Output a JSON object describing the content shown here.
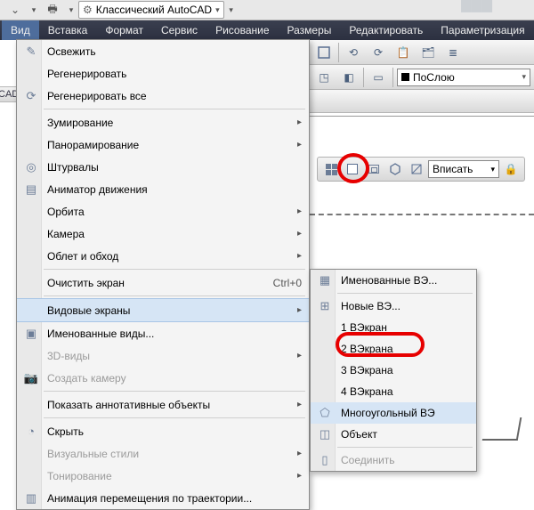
{
  "workspace": {
    "label": "Классический AutoCAD"
  },
  "menubar": {
    "items": [
      "Вид",
      "Вставка",
      "Формат",
      "Сервис",
      "Рисование",
      "Размеры",
      "Редактировать",
      "Параметризация"
    ],
    "active_index": 0
  },
  "layer": {
    "label": "ПоСлою"
  },
  "vp_strip": {
    "combo": "Вписать"
  },
  "sliver": "CAD",
  "menu": {
    "refresh": "Освежить",
    "regen": "Регенерировать",
    "regen_all": "Регенерировать все",
    "zoom": "Зумирование",
    "pan": "Панорамирование",
    "steering": "Штурвалы",
    "motion": "Аниматор движения",
    "orbit": "Орбита",
    "camera": "Камера",
    "walkfly": "Облет и обход",
    "clean": "Очистить экран",
    "clean_sc": "Ctrl+0",
    "viewports": "Видовые экраны",
    "named_views": "Именованные виды...",
    "views3d": "3D-виды",
    "create_cam": "Создать камеру",
    "annot": "Показать аннотативные объекты",
    "hide": "Скрыть",
    "vstyles": "Визуальные стили",
    "render": "Тонирование",
    "mpath": "Анимация перемещения по траектории..."
  },
  "submenu": {
    "named": "Именованные ВЭ...",
    "new": "Новые ВЭ...",
    "vp1": "1 ВЭкран",
    "vp2": "2 ВЭкрана",
    "vp3": "3 ВЭкрана",
    "vp4": "4 ВЭкрана",
    "poly": "Многоугольный ВЭ",
    "object": "Объект",
    "join": "Соединить"
  }
}
